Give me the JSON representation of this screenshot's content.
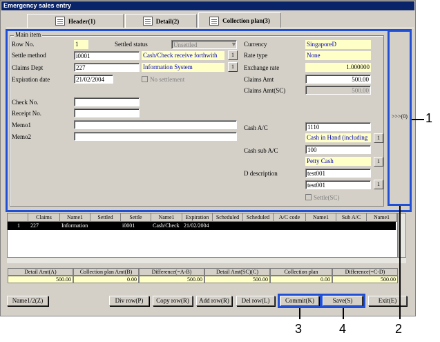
{
  "window": {
    "title": "Emergency sales entry"
  },
  "tabs": [
    {
      "label": "Header(1)"
    },
    {
      "label": "Detail(2)"
    },
    {
      "label": "Collection plan(3)"
    }
  ],
  "main": {
    "legend": "Main item",
    "row_no_label": "Row No.",
    "row_no": "1",
    "settled_status_label": "Settled status",
    "settled_status": "Unsettled",
    "currency_label": "Currency",
    "currency": "SingaporeD",
    "settle_method_label": "Settle method",
    "settle_method": "i0001",
    "settle_method_name": "Cash/Check receive forthwith",
    "rate_type_label": "Rate type",
    "rate_type": "None",
    "claims_dept_label": "Claims Dept",
    "claims_dept": "227",
    "claims_dept_name": "Information System",
    "exchange_rate_label": "Exchange rate",
    "exchange_rate": "1.000000",
    "expiration_label": "Expiration date",
    "expiration": "21/02/2004",
    "no_settlement_label": "No settlement",
    "claims_amt_label": "Claims Amt",
    "claims_amt": "500.00",
    "claims_amt_sc_label": "Claims Amt(SC)",
    "claims_amt_sc": "500.00",
    "check_no_label": "Check No.",
    "receipt_no_label": "Receipt No.",
    "memo1_label": "Memo1",
    "memo2_label": "Memo2",
    "cash_ac_label": "Cash A/C",
    "cash_ac": "1110",
    "cash_ac_name": "Cash in Hand (including",
    "cash_sub_label": "Cash sub A/C",
    "cash_sub": "100",
    "cash_sub_name": "Petty Cash",
    "d_desc_label": "D description",
    "d_desc1": "test001",
    "d_desc2": "test001",
    "settle_sc_label": "Settle(SC)",
    "lookup": "1",
    "side_toggle": ">>>(0)"
  },
  "grid": {
    "headers": [
      "Claims",
      "Name1",
      "Settled",
      "Settle",
      "Name1",
      "Expiration",
      "Scheduled",
      "Scheduled",
      "A/C code",
      "Name1",
      "Sub A/C",
      "Name1"
    ],
    "rows": [
      {
        "no": "1",
        "claims": "227",
        "name1": "Information",
        "settle": "i0001",
        "name1b": "Cash/Check",
        "expiration": "21/02/2004"
      }
    ]
  },
  "summary": {
    "headers": [
      "Detail Amt(A)",
      "Collection plan Amt(B)",
      "Difference(=A-B)",
      "Detail Amt(SC)(C)",
      "Collection plan",
      "Difference(=C-D)"
    ],
    "values": [
      "500.00",
      "0.00",
      "500.00",
      "500.00",
      "0.00",
      "500.00"
    ]
  },
  "buttons": {
    "name12": "Name1/2(Z)",
    "div_row": "Div row(P)",
    "copy_row": "Copy row(R)",
    "add_row": "Add row(R)",
    "del_row": "Del row(L)",
    "commit": "Commit(K)",
    "save": "Save(S)",
    "exit": "Exit(E)"
  },
  "callouts": [
    "1",
    "2",
    "3",
    "4"
  ],
  "colors": {
    "highlight": "#1f4fd6",
    "yellow_field": "#ffffc8",
    "titlebar": "#0a246a"
  }
}
